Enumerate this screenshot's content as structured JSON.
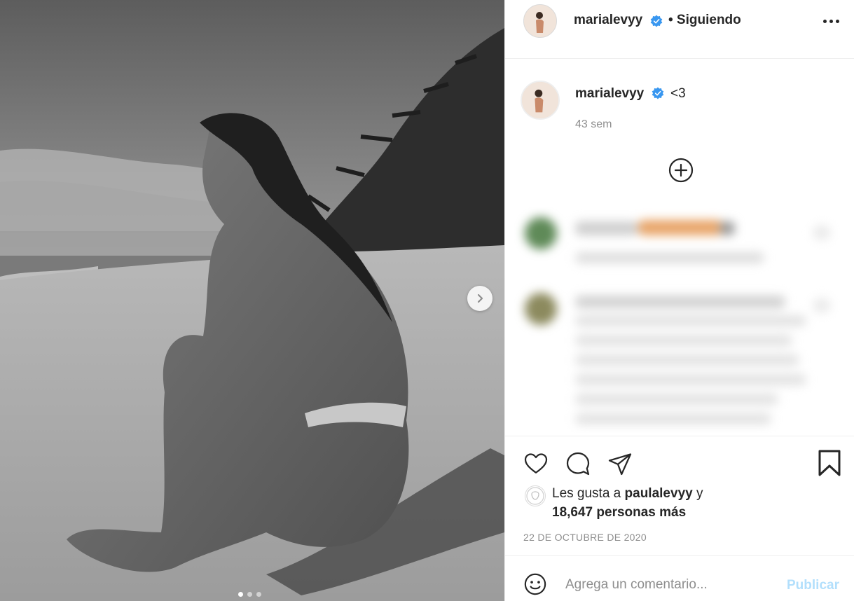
{
  "post": {
    "author": {
      "username": "marialevyy",
      "verified": true,
      "follow_status": "• Siguiendo"
    },
    "photo": {
      "description_icon": "beach-photo",
      "carousel": {
        "count": 3,
        "active_index": 0
      }
    },
    "caption": {
      "username": "marialevyy",
      "text": "<3",
      "time": "43 sem"
    },
    "likes": {
      "prefix": "Les gusta a",
      "friend": "paulalevyy",
      "connector": "y",
      "others": "18,647 personas más"
    },
    "date": "22 DE OCTUBRE DE 2020",
    "comment_box": {
      "placeholder": "Agrega un comentario...",
      "value": "",
      "publish_label": "Publicar"
    }
  },
  "colors": {
    "text": "#262626",
    "muted": "#8e8e8e",
    "verified": "#3897f0",
    "publish_disabled": "#b2dffc",
    "divider": "#efefef"
  },
  "icons": [
    "heart-icon",
    "comment-icon",
    "share-icon",
    "bookmark-icon",
    "emoji-icon",
    "more-options-icon",
    "add-circle-icon",
    "chevron-right-icon",
    "verified-badge-icon"
  ]
}
